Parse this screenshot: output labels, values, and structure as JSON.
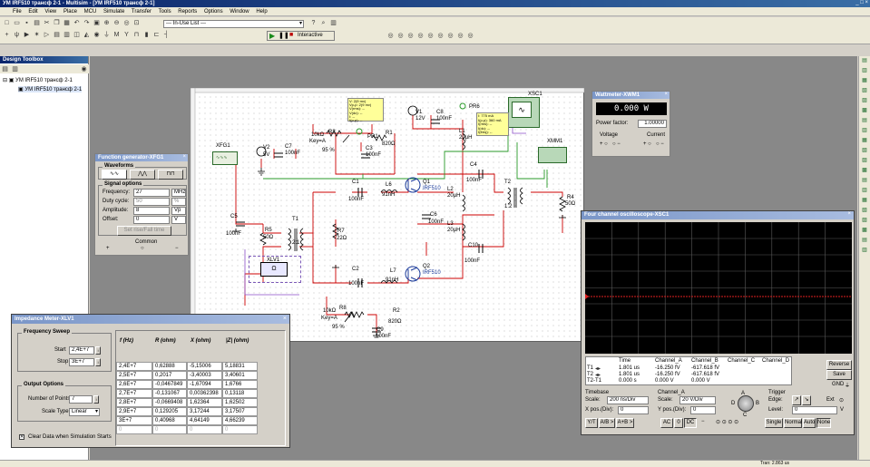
{
  "app": {
    "title": "УМ IRF510 трансф 2-1 - Multisim - [УМ IRF510 трансф 2-1]"
  },
  "menu": [
    "File",
    "Edit",
    "View",
    "Place",
    "MCU",
    "Simulate",
    "Transfer",
    "Tools",
    "Reports",
    "Options",
    "Window",
    "Help"
  ],
  "toolbar": {
    "in_use_list": "--- In-Use List ---",
    "interactive": "Interactive"
  },
  "design_toolbox": {
    "title": "Design Toolbox",
    "tree_root": "УМ IRF510 трансф 2-1",
    "tree_child": "УМ IRF510 трансф 2-1"
  },
  "schematic": {
    "labels": {
      "xfg1": "XFG1",
      "v2": "V2",
      "v2v": "5V",
      "c7": "C7",
      "c7v": "100nF",
      "r3": "R3",
      "r3a": "10kΩ",
      "r3b": "Key=A",
      "r3c": "95 %",
      "pr1": "PR1",
      "r1": "R1",
      "r1v": "820Ω",
      "c3": "C3",
      "c3v": "100nF",
      "v1": "V1",
      "v1v": "12V",
      "c8": "C8",
      "c8v": "100nF",
      "l1": "L1",
      "l1v": "20µH",
      "pr6": "PR6",
      "xsc1": "XSC1",
      "xmm1": "XMM1",
      "c4": "C4",
      "c4v": "100nF",
      "t2": "T2",
      "t2v": "1:2",
      "r4": "R4",
      "r4v": "50Ω",
      "c1": "C1",
      "c1v": "100nF",
      "l6": "L6",
      "l6v": "91nH",
      "q1": "Q1",
      "q1v": "IRF510",
      "l2": "L2",
      "l2v": "20µH",
      "c6": "C6",
      "c6v": "100nF",
      "l3": "L3",
      "l3v": "20µH",
      "c5": "C5",
      "c5v": "100nF",
      "t1": "T1",
      "t1v": "2:1",
      "r5": "R5",
      "r5v": "50Ω",
      "r7": "R7",
      "r7v": "22Ω",
      "c10": "C10",
      "c10v": "100nF",
      "xlv1": "XLV1",
      "c2": "C2",
      "c2v": "100nF",
      "l7": "L7",
      "l7v": "91nH",
      "q2": "Q2",
      "q2v": "IRF510",
      "r8": "R8",
      "r8a": "10kΩ",
      "r8b": "Key=A",
      "r8c": "95 %",
      "r2": "R2",
      "r2v": "820Ω",
      "c9": "C9",
      "c9v": "100nF"
    },
    "probe1": [
      "V: 2(9 mv)",
      "Vp-p: 2(9 mv)",
      "V(rms): --",
      "V(dc): --",
      "I: --",
      "I(p-p): --"
    ],
    "probe2": [
      "I: 775 mA",
      "I(p-p): 360 mA",
      "I(rms): --",
      "I(dc): --",
      "I(freq): --"
    ]
  },
  "function_generator": {
    "title": "Function generator-XFG1",
    "waveforms": "Waveforms",
    "signal_options": "Signal options",
    "rows": [
      {
        "label": "Frequency:",
        "value": "27",
        "unit": "MHz"
      },
      {
        "label": "Duty cycle:",
        "value": "50",
        "unit": "%"
      },
      {
        "label": "Amplitude:",
        "value": "8",
        "unit": "Vp"
      },
      {
        "label": "Offset:",
        "value": "0",
        "unit": "V"
      }
    ],
    "set_button": "Set rise/Fall time",
    "common": "Common"
  },
  "wattmeter": {
    "title": "Wattmeter-XWM1",
    "display": "0.000 W",
    "pf_label": "Power factor:",
    "pf_value": "1.00000",
    "voltage": "Voltage",
    "current": "Current"
  },
  "impedance": {
    "title": "Impedance Meter-XLV1",
    "freq_sweep": "Frequency Sweep",
    "start_label": "Start",
    "start_value": "2,4E+7",
    "stop_label": "Stop",
    "stop_value": "3E+7",
    "output_options": "Output Options",
    "points_label": "Number of Points",
    "points_value": "7",
    "scale_label": "Scale Type",
    "scale_value": "Linear",
    "clear_label": "Clear Data when Simulation Starts",
    "headers": [
      "f (Hz)",
      "R (ohm)",
      "X (ohm)",
      "|Z| (ohm)"
    ],
    "rows": [
      [
        "2,4E+7",
        "0,62888",
        "-5,15006",
        "5,18831"
      ],
      [
        "2,5E+7",
        "0,2017",
        "-3,40003",
        "3,40601"
      ],
      [
        "2,6E+7",
        "-0,0467849",
        "-1,67094",
        "1,6766"
      ],
      [
        "2,7E+7",
        "-0,131067",
        "0,00362398",
        "0,13118"
      ],
      [
        "2,8E+7",
        "-0,0669408",
        "1,62364",
        "1,62502"
      ],
      [
        "2,9E+7",
        "0,129205",
        "3,17244",
        "3,17507"
      ],
      [
        "3E+7",
        "0,40968",
        "4,64149",
        "4,66239"
      ],
      [
        "0",
        "0",
        "0",
        "0"
      ]
    ]
  },
  "oscilloscope": {
    "title": "Four channel oscilloscope-XSC1",
    "headers": [
      "",
      "Time",
      "Channel_A",
      "Channel_B",
      "Channel_C",
      "Channel_D"
    ],
    "rows": [
      [
        "T1",
        "1.801 us",
        "-16.250 fV",
        "-617.618 fV",
        "",
        ""
      ],
      [
        "T2",
        "1.801 us",
        "-16.250 fV",
        "-617.618 fV",
        "",
        ""
      ],
      [
        "T2-T1",
        "0.000 s",
        "0.000 V",
        "0.000 V",
        "",
        ""
      ]
    ],
    "reverse": "Reverse",
    "save": "Save",
    "gnd": "GND",
    "timebase": "Timebase",
    "scale_label": "Scale:",
    "timebase_scale": "200 ns/Div",
    "xpos_label": "X pos.(Div):",
    "xpos": "0",
    "ya_btn": "Y/T",
    "ab_btn": "A/B >",
    "apb_btn": "A+B >",
    "channel_label": "Channel_A",
    "ch_scale": "20 V/Div",
    "ypos_label": "Y pos.(Div):",
    "ypos": "0",
    "ac": "AC",
    "dc": "DC",
    "zero": "0",
    "trigger": "Trigger",
    "edge": "Edge:",
    "level": "Level:",
    "level_value": "0",
    "level_unit": "V",
    "ext": "Ext",
    "single": "Single",
    "normal": "Normal",
    "auto": "Auto",
    "none": "None"
  },
  "status": {
    "tran": "Tran: 2.863 us"
  }
}
